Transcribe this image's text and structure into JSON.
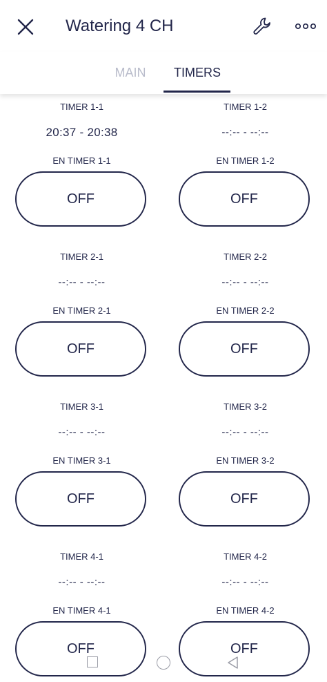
{
  "header": {
    "title": "Watering 4 CH",
    "close_icon": "close-icon",
    "settings_icon": "wrench-icon",
    "more_icon": "more-dots-icon"
  },
  "tabs": [
    {
      "label": "MAIN",
      "active": false
    },
    {
      "label": "TIMERS",
      "active": true
    }
  ],
  "timers": [
    {
      "left": {
        "label": "TIMER 1-1",
        "value": "20:37 - 20:38",
        "en_label": "EN TIMER 1-1",
        "state": "OFF"
      },
      "right": {
        "label": "TIMER 1-2",
        "value": "--:-- - --:--",
        "en_label": "EN TIMER 1-2",
        "state": "OFF"
      }
    },
    {
      "left": {
        "label": "TIMER 2-1",
        "value": "--:-- - --:--",
        "en_label": "EN TIMER 2-1",
        "state": "OFF"
      },
      "right": {
        "label": "TIMER 2-2",
        "value": "--:-- - --:--",
        "en_label": "EN TIMER 2-2",
        "state": "OFF"
      }
    },
    {
      "left": {
        "label": "TIMER 3-1",
        "value": "--:-- - --:--",
        "en_label": "EN TIMER 3-1",
        "state": "OFF"
      },
      "right": {
        "label": "TIMER 3-2",
        "value": "--:-- - --:--",
        "en_label": "EN TIMER 3-2",
        "state": "OFF"
      }
    },
    {
      "left": {
        "label": "TIMER 4-1",
        "value": "--:-- - --:--",
        "en_label": "EN TIMER 4-1",
        "state": "OFF"
      },
      "right": {
        "label": "TIMER 4-2",
        "value": "--:-- - --:--",
        "en_label": "EN TIMER 4-2",
        "state": "OFF"
      }
    }
  ],
  "system_nav": {
    "recent_icon": "recent-apps-icon",
    "home_icon": "home-icon",
    "back_icon": "back-icon"
  },
  "colors": {
    "primary": "#22264a",
    "inactive_tab": "#b9bccb",
    "background": "#ffffff"
  }
}
